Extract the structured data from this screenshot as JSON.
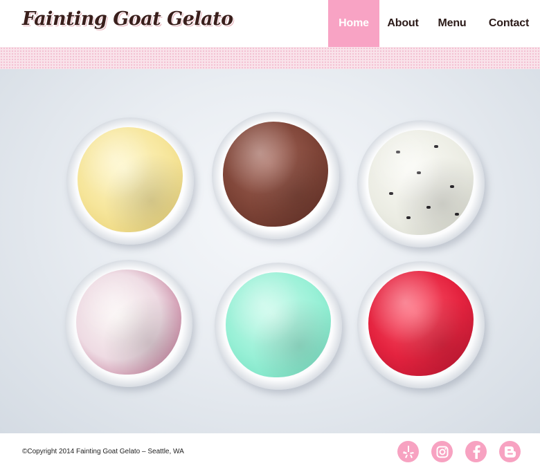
{
  "brand": {
    "logo_text": "Fainting Goat Gelato"
  },
  "nav": {
    "items": [
      {
        "label": "Home",
        "active": true
      },
      {
        "label": "About",
        "active": false
      },
      {
        "label": "Menu",
        "active": false
      },
      {
        "label": "Contact",
        "active": false
      }
    ]
  },
  "hero": {
    "image_subject": "six cups of gelato",
    "flavors_visible": [
      "vanilla",
      "chocolate",
      "cookies-and-cream",
      "berry-swirl",
      "mint",
      "raspberry"
    ]
  },
  "footer": {
    "copyright": "©Copyright 2014 Fainting Goat Gelato – Seattle, WA",
    "social_icons": [
      "yelp-icon",
      "instagram-icon",
      "facebook-icon",
      "blogger-icon"
    ]
  },
  "colors": {
    "accent_pink": "#f8a3c4",
    "logo_brown": "#3a1f1c",
    "nav_text": "#2b1a18"
  }
}
